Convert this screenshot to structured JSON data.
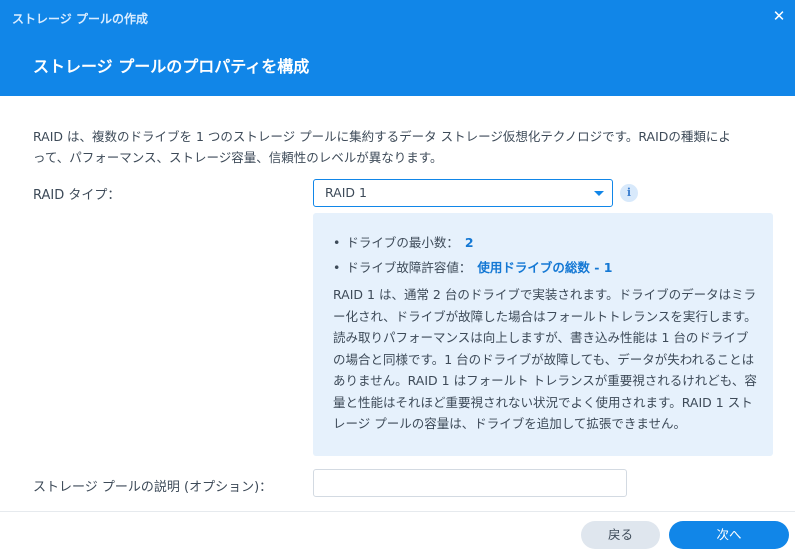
{
  "window": {
    "title": "ストレージ プールの作成",
    "close_symbol": "✕"
  },
  "header": {
    "heading": "ストレージ プールのプロパティを構成"
  },
  "main": {
    "description_line1": "RAID は、複数のドライブを 1 つのストレージ プールに集約するデータ ストレージ仮想化テクノロジです。RAIDの種類によ",
    "description_line2": "って、パフォーマンス、ストレージ容量、信頼性のレベルが異なります。",
    "raid_type_label": "RAID タイプ：",
    "raid_type_value": "RAID 1",
    "info_icon_glyph": "i",
    "info": {
      "bullet1_label": "ドライブの最小数：",
      "bullet1_value": "2",
      "bullet2_label": "ドライブ故障許容値：",
      "bullet2_value": "使用ドライブの総数 - 1",
      "text": "RAID 1 は、通常 2 台のドライブで実装されます。ドライブのデータはミラー化され、ドライブが故障した場合はフォールトトレランスを実行します。読み取りパフォーマンスは向上しますが、書き込み性能は 1 台のドライブの場合と同様です。1 台のドライブが故障しても、データが失われることはありません。RAID 1 はフォールト トレランスが重要視されるけれども、容量と性能はそれほど重要視されない状況でよく使用されます。RAID 1 ストレージ プールの容量は、ドライブを追加して拡張できません。"
    },
    "pool_description_label": "ストレージ プールの説明 (オプション)：",
    "pool_description_value": ""
  },
  "footer": {
    "back_label": "戻る",
    "next_label": "次へ"
  },
  "colors": {
    "accent": "#1186e8",
    "info_box_bg": "#e6f1fc",
    "highlight_text": "#1478d4"
  },
  "icons": {
    "close": "close-icon",
    "info": "info-icon",
    "dropdown": "chevron-down-icon"
  }
}
